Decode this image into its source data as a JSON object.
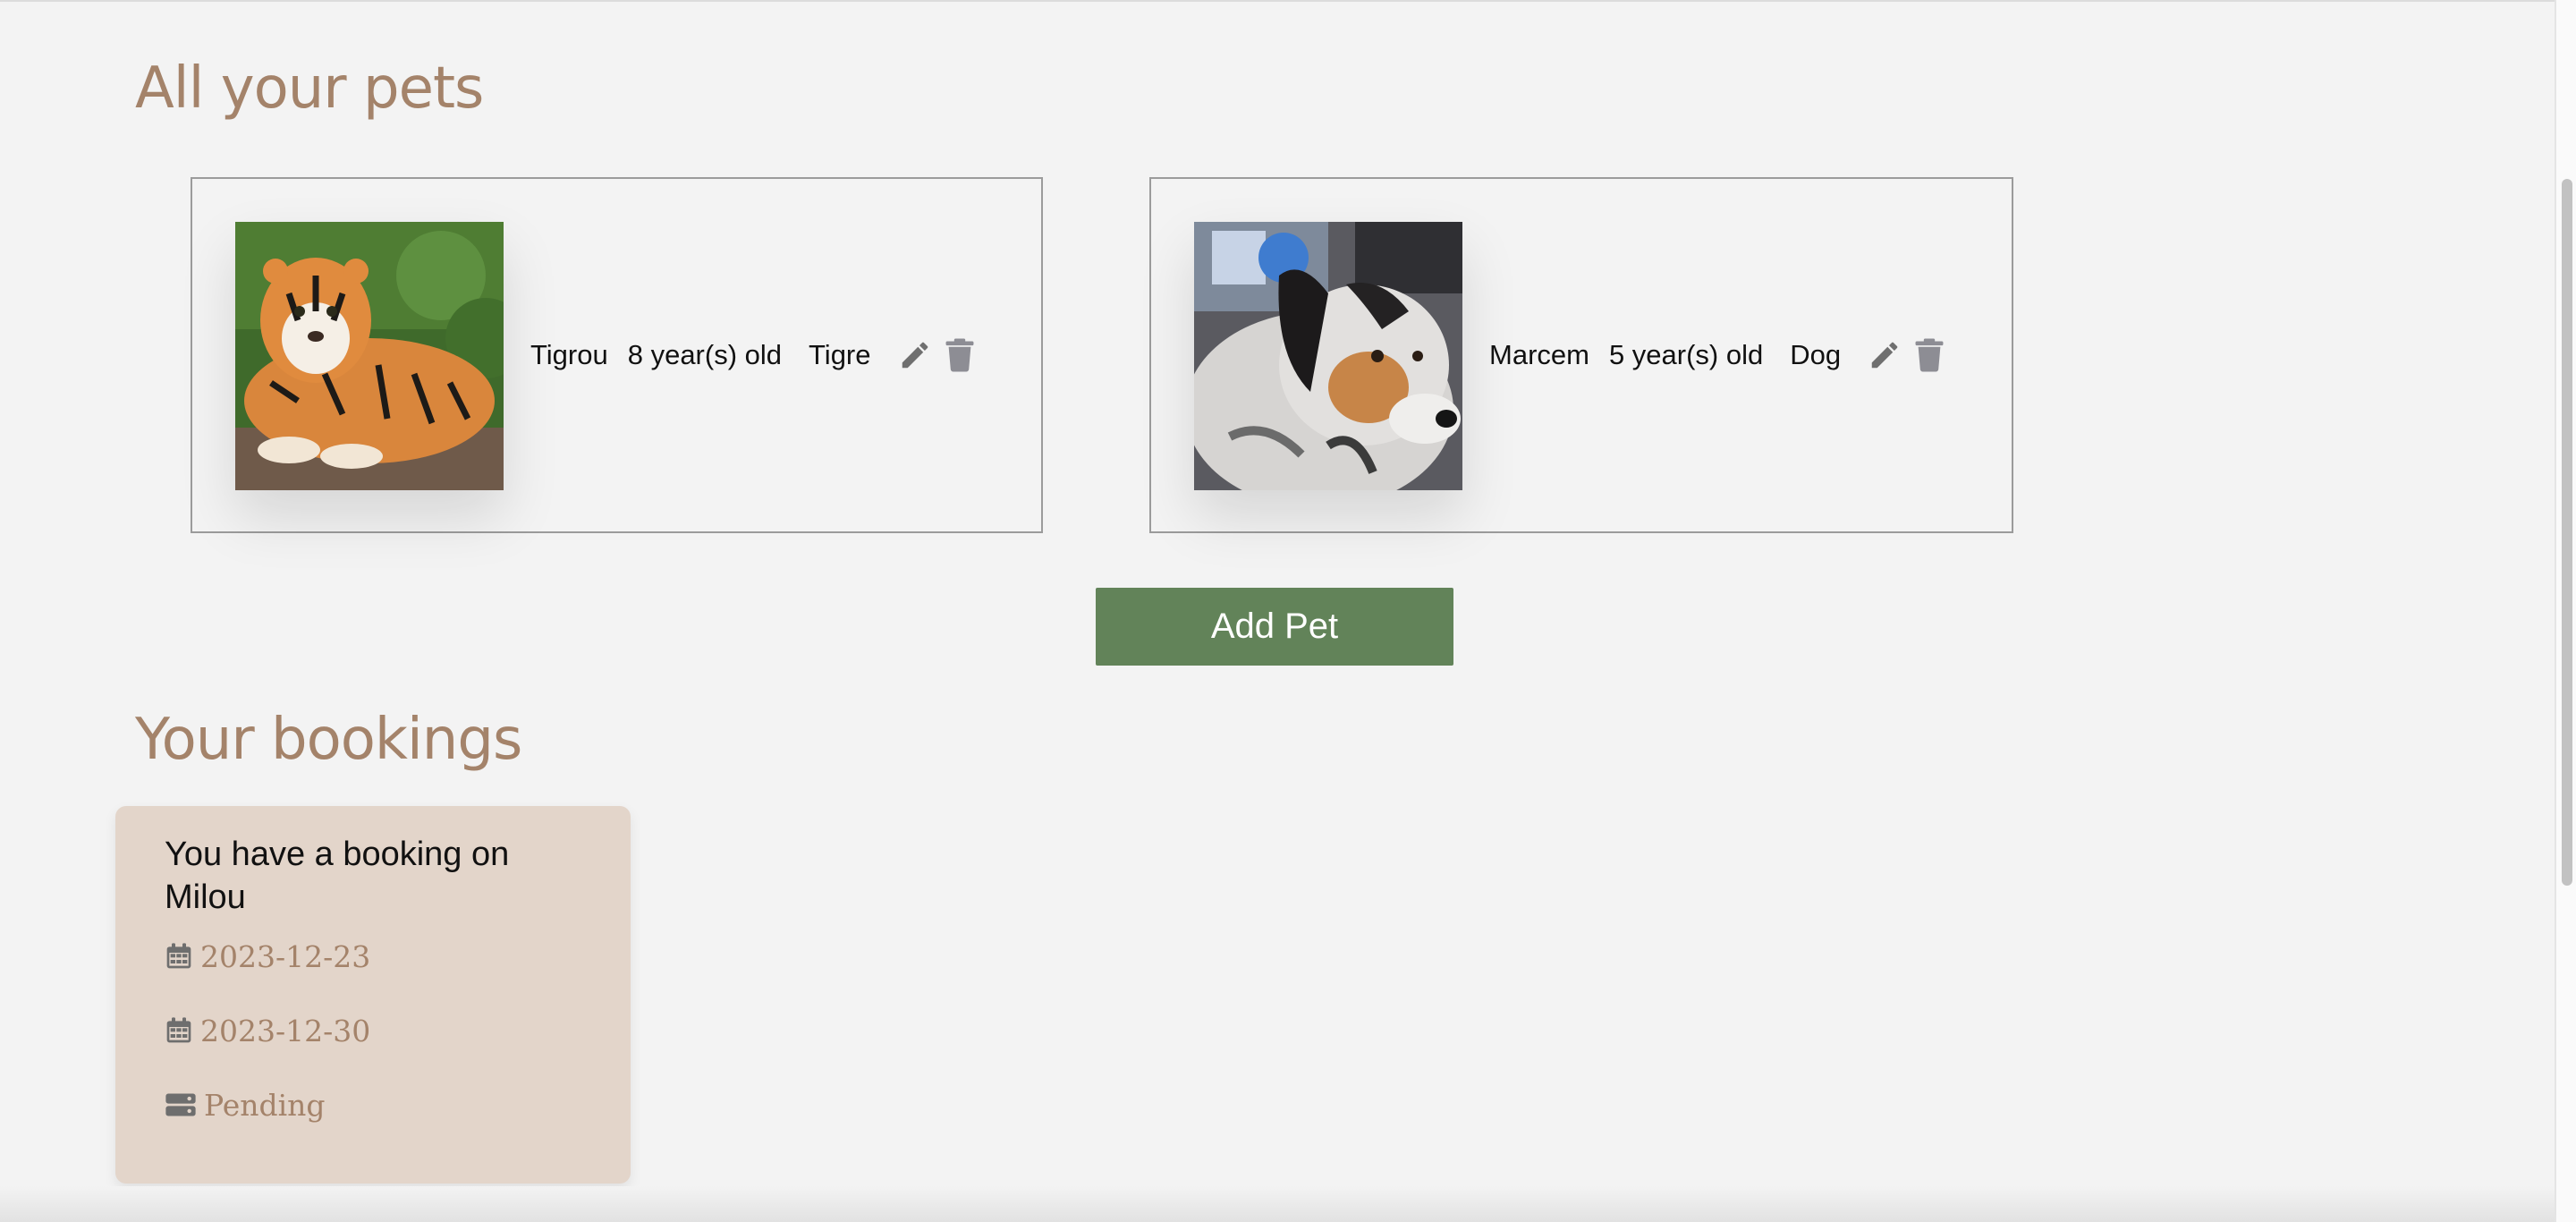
{
  "pets_section": {
    "title": "All your pets"
  },
  "pets": [
    {
      "name": "Tigrou",
      "age": "8 year(s) old",
      "species": "Tigre",
      "photo": "tiger-photo"
    },
    {
      "name": "Marcem",
      "age": "5 year(s) old",
      "species": "Dog",
      "photo": "dog-photo"
    }
  ],
  "add_pet_label": "Add Pet",
  "bookings_section": {
    "title": "Your bookings"
  },
  "bookings": [
    {
      "title": "You have a booking on Milou",
      "start_date": "2023-12-23",
      "end_date": "2023-12-30",
      "status": "Pending"
    }
  ],
  "icons": {
    "edit": "pencil-icon",
    "delete": "trash-icon",
    "date": "calendar-icon",
    "status": "server-icon"
  },
  "colors": {
    "heading": "#a4836a",
    "button": "#628359",
    "booking_card": "#e3d5ca",
    "background": "#f3f3f3"
  }
}
